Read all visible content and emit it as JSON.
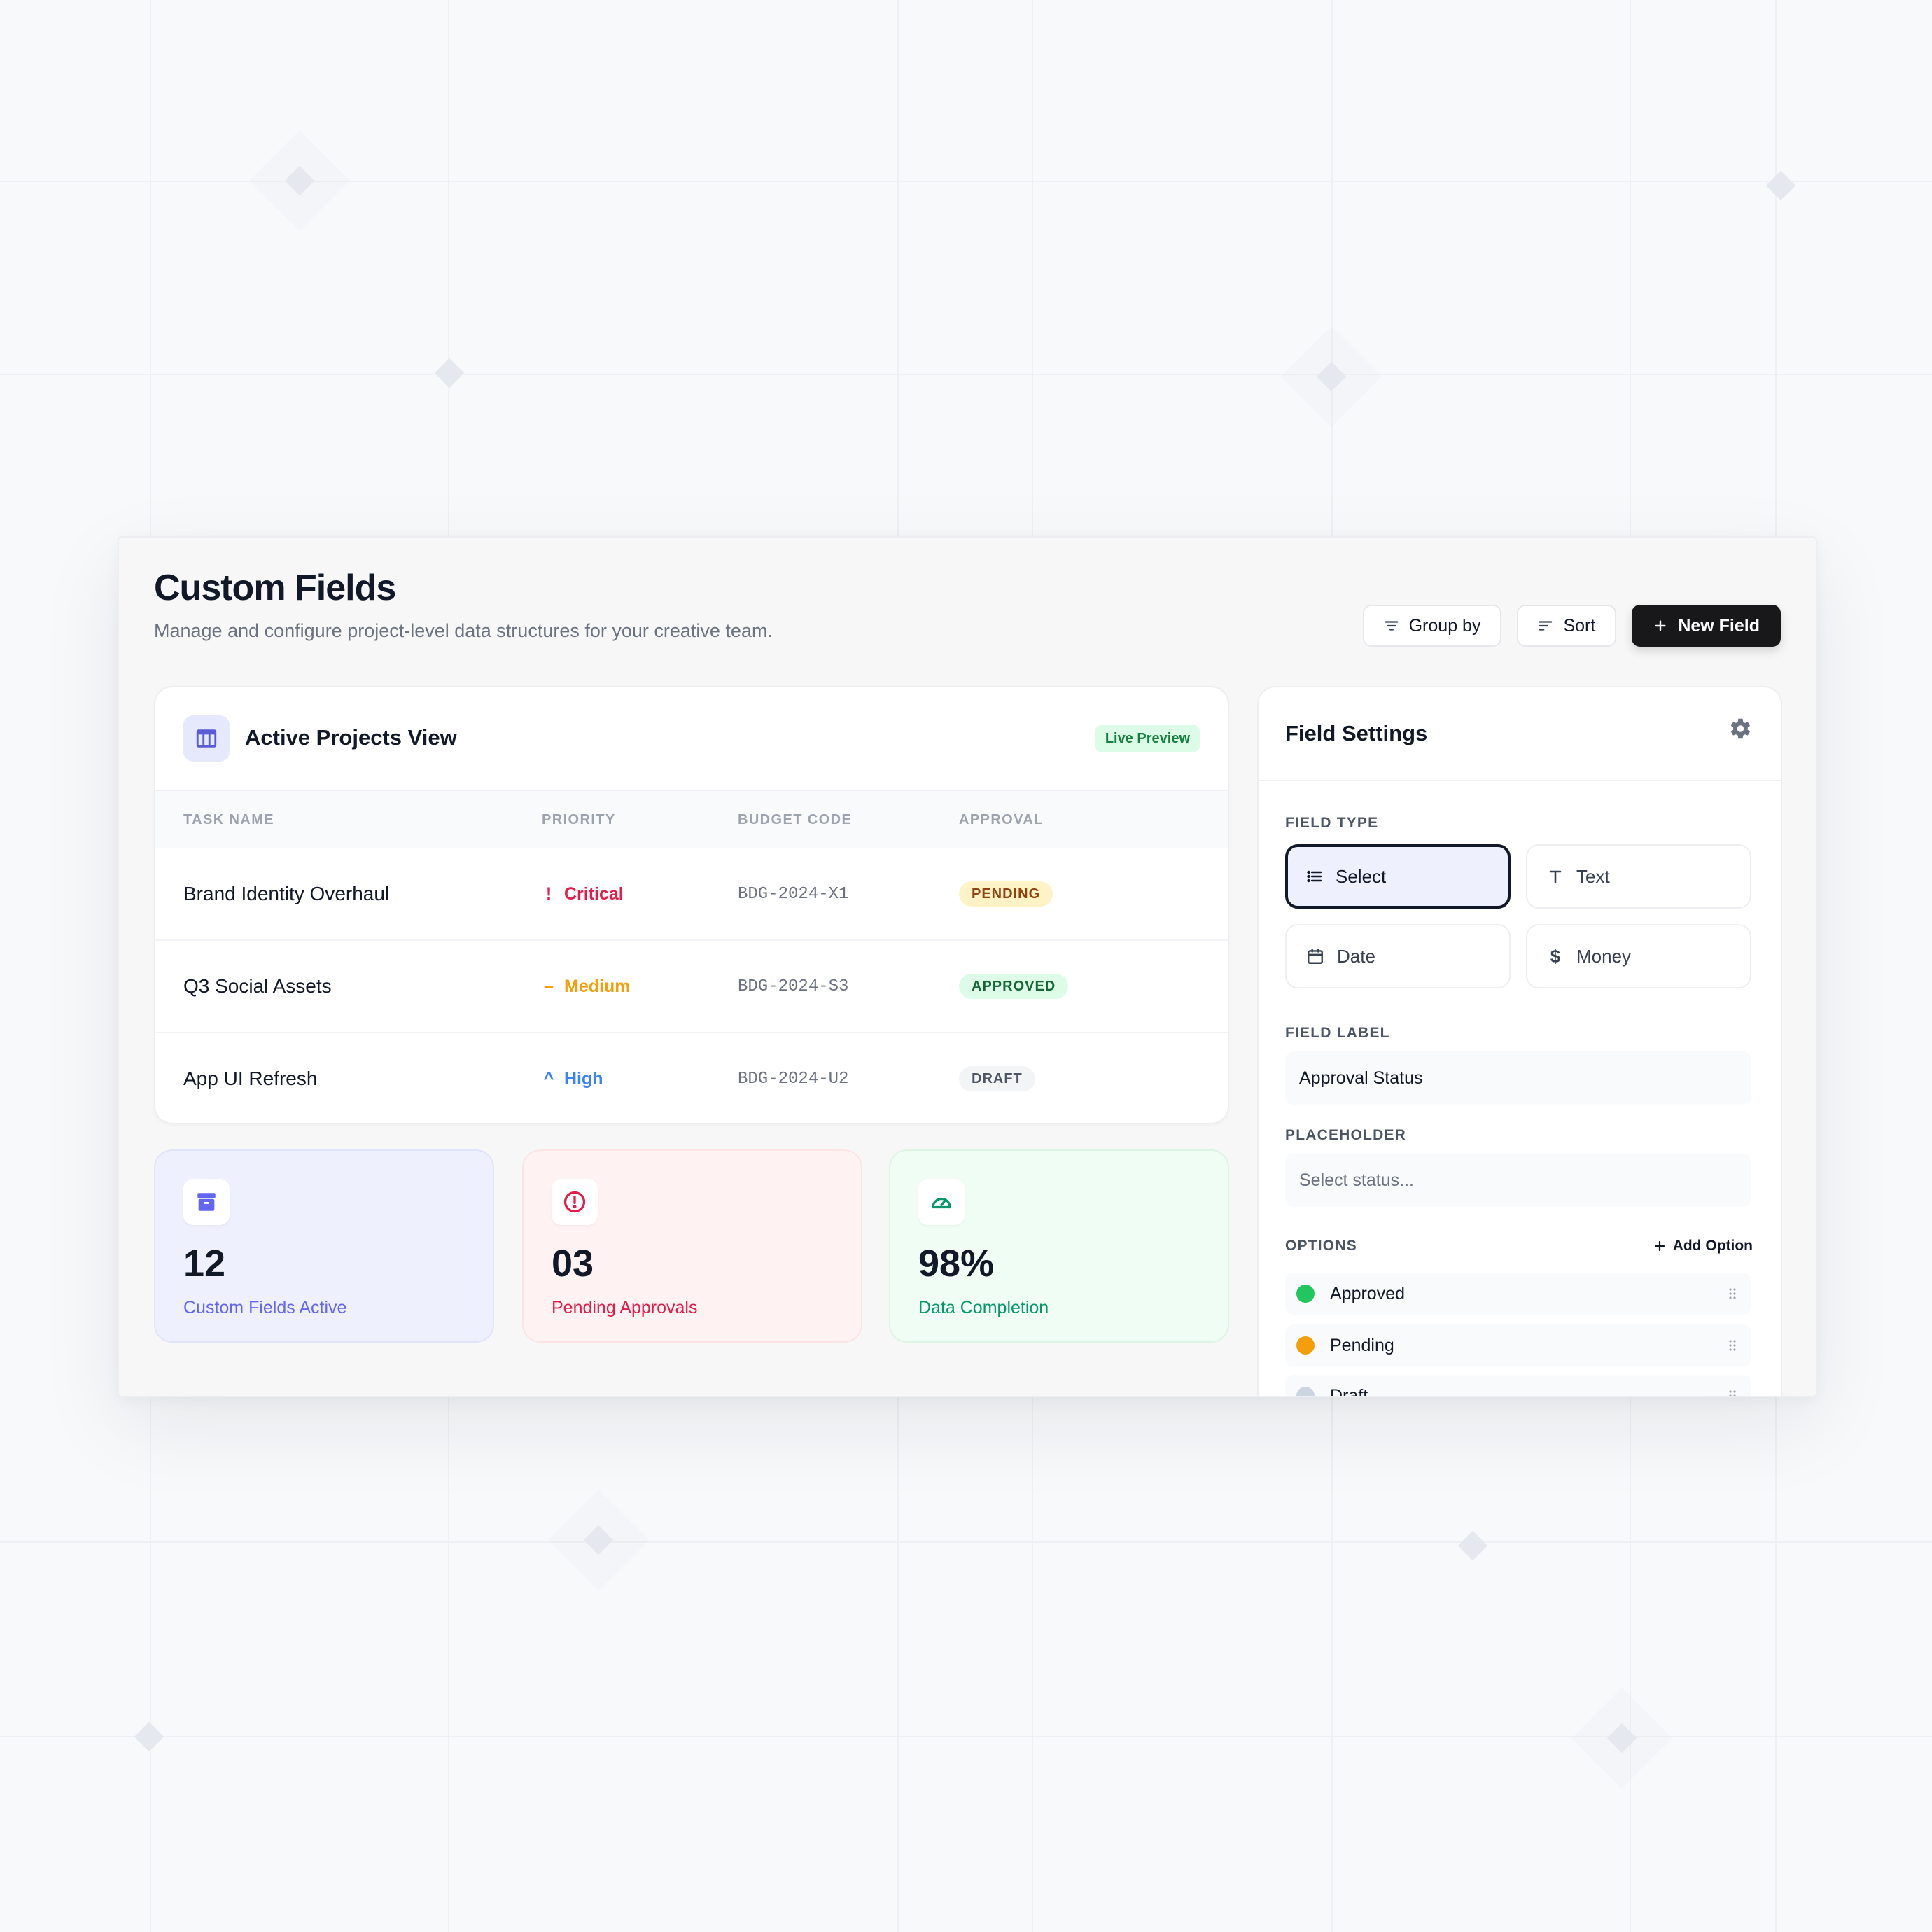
{
  "header": {
    "title": "Custom Fields",
    "subtitle": "Manage and configure project-level data structures for your creative team."
  },
  "toolbar": {
    "group_by_label": "Group by",
    "sort_label": "Sort",
    "new_field_label": "New Field"
  },
  "projects_view": {
    "title": "Active Projects View",
    "badge": "Live Preview",
    "columns": [
      "TASK NAME",
      "PRIORITY",
      "BUDGET CODE",
      "APPROVAL"
    ],
    "rows": [
      {
        "task": "Brand Identity Overhaul",
        "priority_glyph": "!",
        "priority": "Critical",
        "priority_color": "#e11d48",
        "code": "BDG-2024-X1",
        "approval": "PENDING",
        "approval_bg": "#fef3c7",
        "approval_color": "#92400e"
      },
      {
        "task": "Q3 Social Assets",
        "priority_glyph": "–",
        "priority": "Medium",
        "priority_color": "#f59e0b",
        "code": "BDG-2024-S3",
        "approval": "APPROVED",
        "approval_bg": "#dcfce7",
        "approval_color": "#166534"
      },
      {
        "task": "App UI Refresh",
        "priority_glyph": "^",
        "priority": "High",
        "priority_color": "#3b82f6",
        "code": "BDG-2024-U2",
        "approval": "DRAFT",
        "approval_bg": "#f3f4f6",
        "approval_color": "#4b5563"
      }
    ]
  },
  "stats": [
    {
      "icon": "archive-icon",
      "value": "12",
      "label": "Custom Fields Active",
      "bg": "#eef0fd",
      "border": "#e0e4fb",
      "accent": "#6366f1"
    },
    {
      "icon": "alert-circle-icon",
      "value": "03",
      "label": "Pending Approvals",
      "bg": "#fef2f2",
      "border": "#fde4e4",
      "accent": "#e11d48"
    },
    {
      "icon": "gauge-icon",
      "value": "98%",
      "label": "Data Completion",
      "bg": "#f0fdf4",
      "border": "#dcf5e3",
      "accent": "#059669"
    }
  ],
  "settings": {
    "title": "Field Settings",
    "field_type_label": "FIELD TYPE",
    "types": [
      {
        "label": "Select",
        "icon": "list-icon",
        "selected": true
      },
      {
        "label": "Text",
        "icon": "text-icon",
        "selected": false
      },
      {
        "label": "Date",
        "icon": "calendar-icon",
        "selected": false
      },
      {
        "label": "Money",
        "icon": "dollar-icon",
        "selected": false
      }
    ],
    "field_label_label": "FIELD LABEL",
    "field_label_value": "Approval Status",
    "placeholder_label": "PLACEHOLDER",
    "placeholder_value": "Select status...",
    "options_label": "OPTIONS",
    "add_option_label": "Add Option",
    "options": [
      {
        "label": "Approved",
        "color": "#22c55e"
      },
      {
        "label": "Pending",
        "color": "#f59e0b"
      },
      {
        "label": "Draft",
        "color": "#cbd5e1"
      }
    ]
  },
  "colors": {
    "primary_button": "#18181b",
    "accent_indigo": "#5b5bd6"
  }
}
